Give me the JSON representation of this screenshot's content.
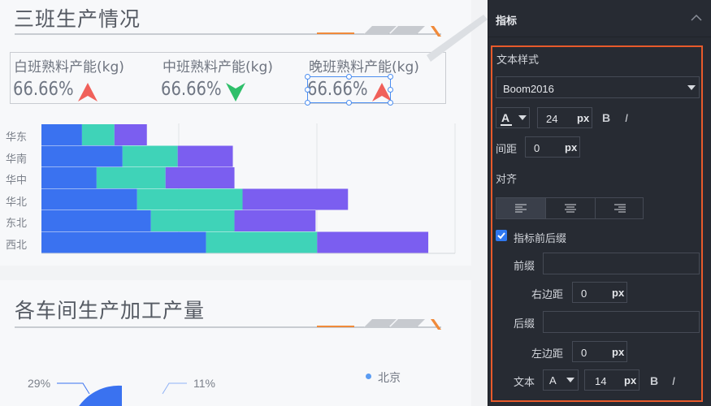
{
  "canvas": {
    "card1": {
      "title": "三班生产情况",
      "kpis": [
        {
          "label": "白班熟料产能(kg)",
          "value": "66.66%",
          "trend": "up"
        },
        {
          "label": "中班熟料产能(kg)",
          "value": "66.66%",
          "trend": "down"
        },
        {
          "label": "晚班熟料产能(kg)",
          "value": "66.66%",
          "trend": "up"
        }
      ]
    },
    "chart_data": {
      "type": "bar",
      "orientation": "horizontal",
      "stacked": true,
      "categories": [
        "华东",
        "华南",
        "华中",
        "华北",
        "东北",
        "西北"
      ],
      "series": [
        {
          "values": [
            50,
            100,
            68,
            118,
            135,
            203
          ]
        },
        {
          "values": [
            40,
            68,
            85,
            130,
            103,
            137
          ]
        },
        {
          "values": [
            40,
            68,
            85,
            130,
            100,
            137
          ]
        }
      ],
      "colors": [
        "#3a72f0",
        "#3fd3b8",
        "#7b5ef0"
      ],
      "xlim": [
        0,
        510
      ]
    },
    "card2": {
      "title": "各车间生产加工产量",
      "pie_labels": [
        "29%",
        "11%"
      ],
      "legend": [
        "北京"
      ]
    }
  },
  "panel": {
    "title": "指标",
    "section": "文本样式",
    "font_family": "Boom2016",
    "font_size": "24",
    "unit_px": "px",
    "bold": "B",
    "italic": "I",
    "spacing_label": "间距",
    "spacing_value": "0",
    "align_label": "对齐",
    "affix_label": "指标前后缀",
    "prefix_label": "前缀",
    "prefix_value": "",
    "right_margin_label": "右边距",
    "right_margin_value": "0",
    "suffix_label": "后缀",
    "suffix_value": "",
    "left_margin_label": "左边距",
    "left_margin_value": "0",
    "text_label": "文本",
    "text_size": "14",
    "font_glyph": "A",
    "colors": {
      "accent": "#e85a2b",
      "check": "#2f78f0",
      "bg": "#272b33"
    }
  }
}
